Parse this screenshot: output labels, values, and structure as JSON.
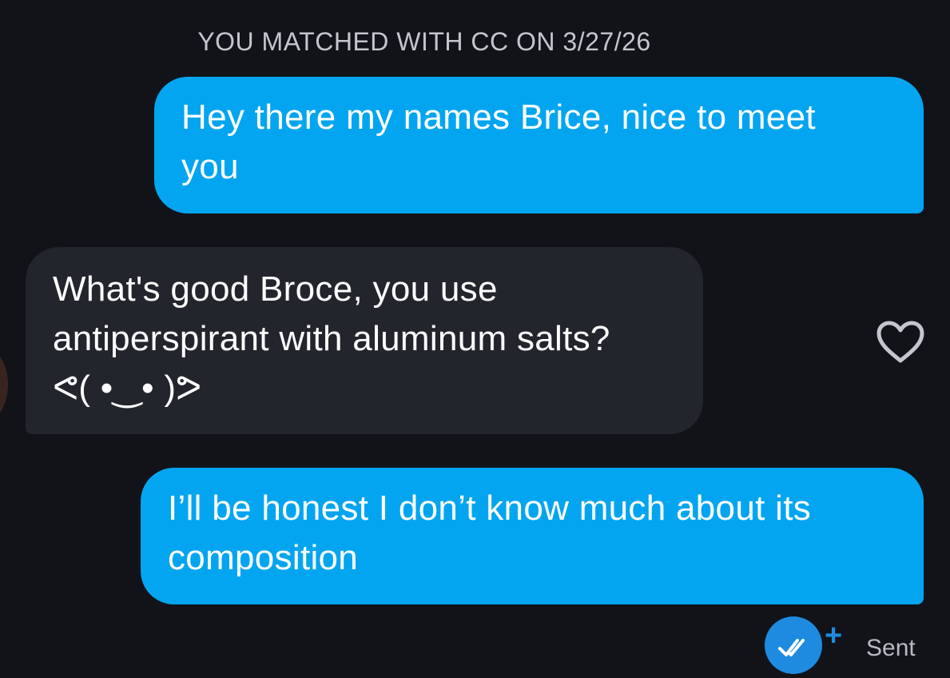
{
  "header": {
    "match_text": "YOU MATCHED WITH CC ON 3/27/26"
  },
  "messages": [
    {
      "sender": "me",
      "lines": [
        "Hey there my names Brice, nice to meet",
        "you"
      ]
    },
    {
      "sender": "match",
      "lines": [
        "What's good Broce, you use",
        "antiperspirant with aluminum salts?",
        "ᕙ( •‿• )ᕗ"
      ]
    },
    {
      "sender": "me",
      "lines": [
        "I’ll be honest I don’t know much about its",
        "composition"
      ]
    }
  ],
  "status": {
    "read_receipt_icon": "double-check-icon",
    "plus_label": "+",
    "sent_label": "Sent"
  },
  "icons": {
    "like": "heart-outline-icon"
  },
  "colors": {
    "background": "#111318",
    "sent_bubble": "#04a5f0",
    "received_bubble": "#22252c",
    "receipt_accent": "#1e8be0"
  }
}
